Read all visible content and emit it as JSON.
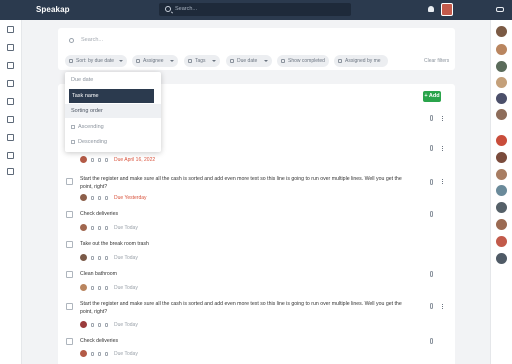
{
  "app": {
    "name": "Speakap"
  },
  "topbar": {
    "search_placeholder": "Search..."
  },
  "filters": {
    "search_placeholder": "Search...",
    "chips": [
      "Sort: by due date",
      "Assignee",
      "Tags",
      "Due date",
      "Show completed",
      "Assigned by me"
    ],
    "clear_label": "Clear filters"
  },
  "sort_menu": {
    "options": [
      "Due date",
      "Task name"
    ],
    "selected": "Task name",
    "order_header": "Sorting order",
    "orders": [
      "Ascending",
      "Descending"
    ]
  },
  "list": {
    "add_label": "+ Add",
    "tasks": [
      {
        "title": "",
        "due": "Due April 16, 2022",
        "overdue": true
      },
      {
        "title": "Start the register and make sure all the cash is sorted and add even more text so this line is going to run over multiple lines. Well you get the point, right?",
        "due": "Due Yesterday",
        "overdue": true
      },
      {
        "title": "Check deliveries",
        "due": "Due Today",
        "overdue": false
      },
      {
        "title": "Take out the break room trash",
        "due": "Due Today",
        "overdue": false
      },
      {
        "title": "Clean bathroom",
        "due": "Due Today",
        "overdue": false
      },
      {
        "title": "Start the register and make sure all the cash is sorted and add even more text so this line is going to run over multiple lines. Well you get the point, right?",
        "due": "Due Today",
        "overdue": false
      },
      {
        "title": "Check deliveries",
        "due": "Due Today",
        "overdue": false
      }
    ]
  },
  "colors": {
    "topbar": "#2b3a4e",
    "accent_green": "#2aa44b",
    "overdue_red": "#d9533c"
  }
}
